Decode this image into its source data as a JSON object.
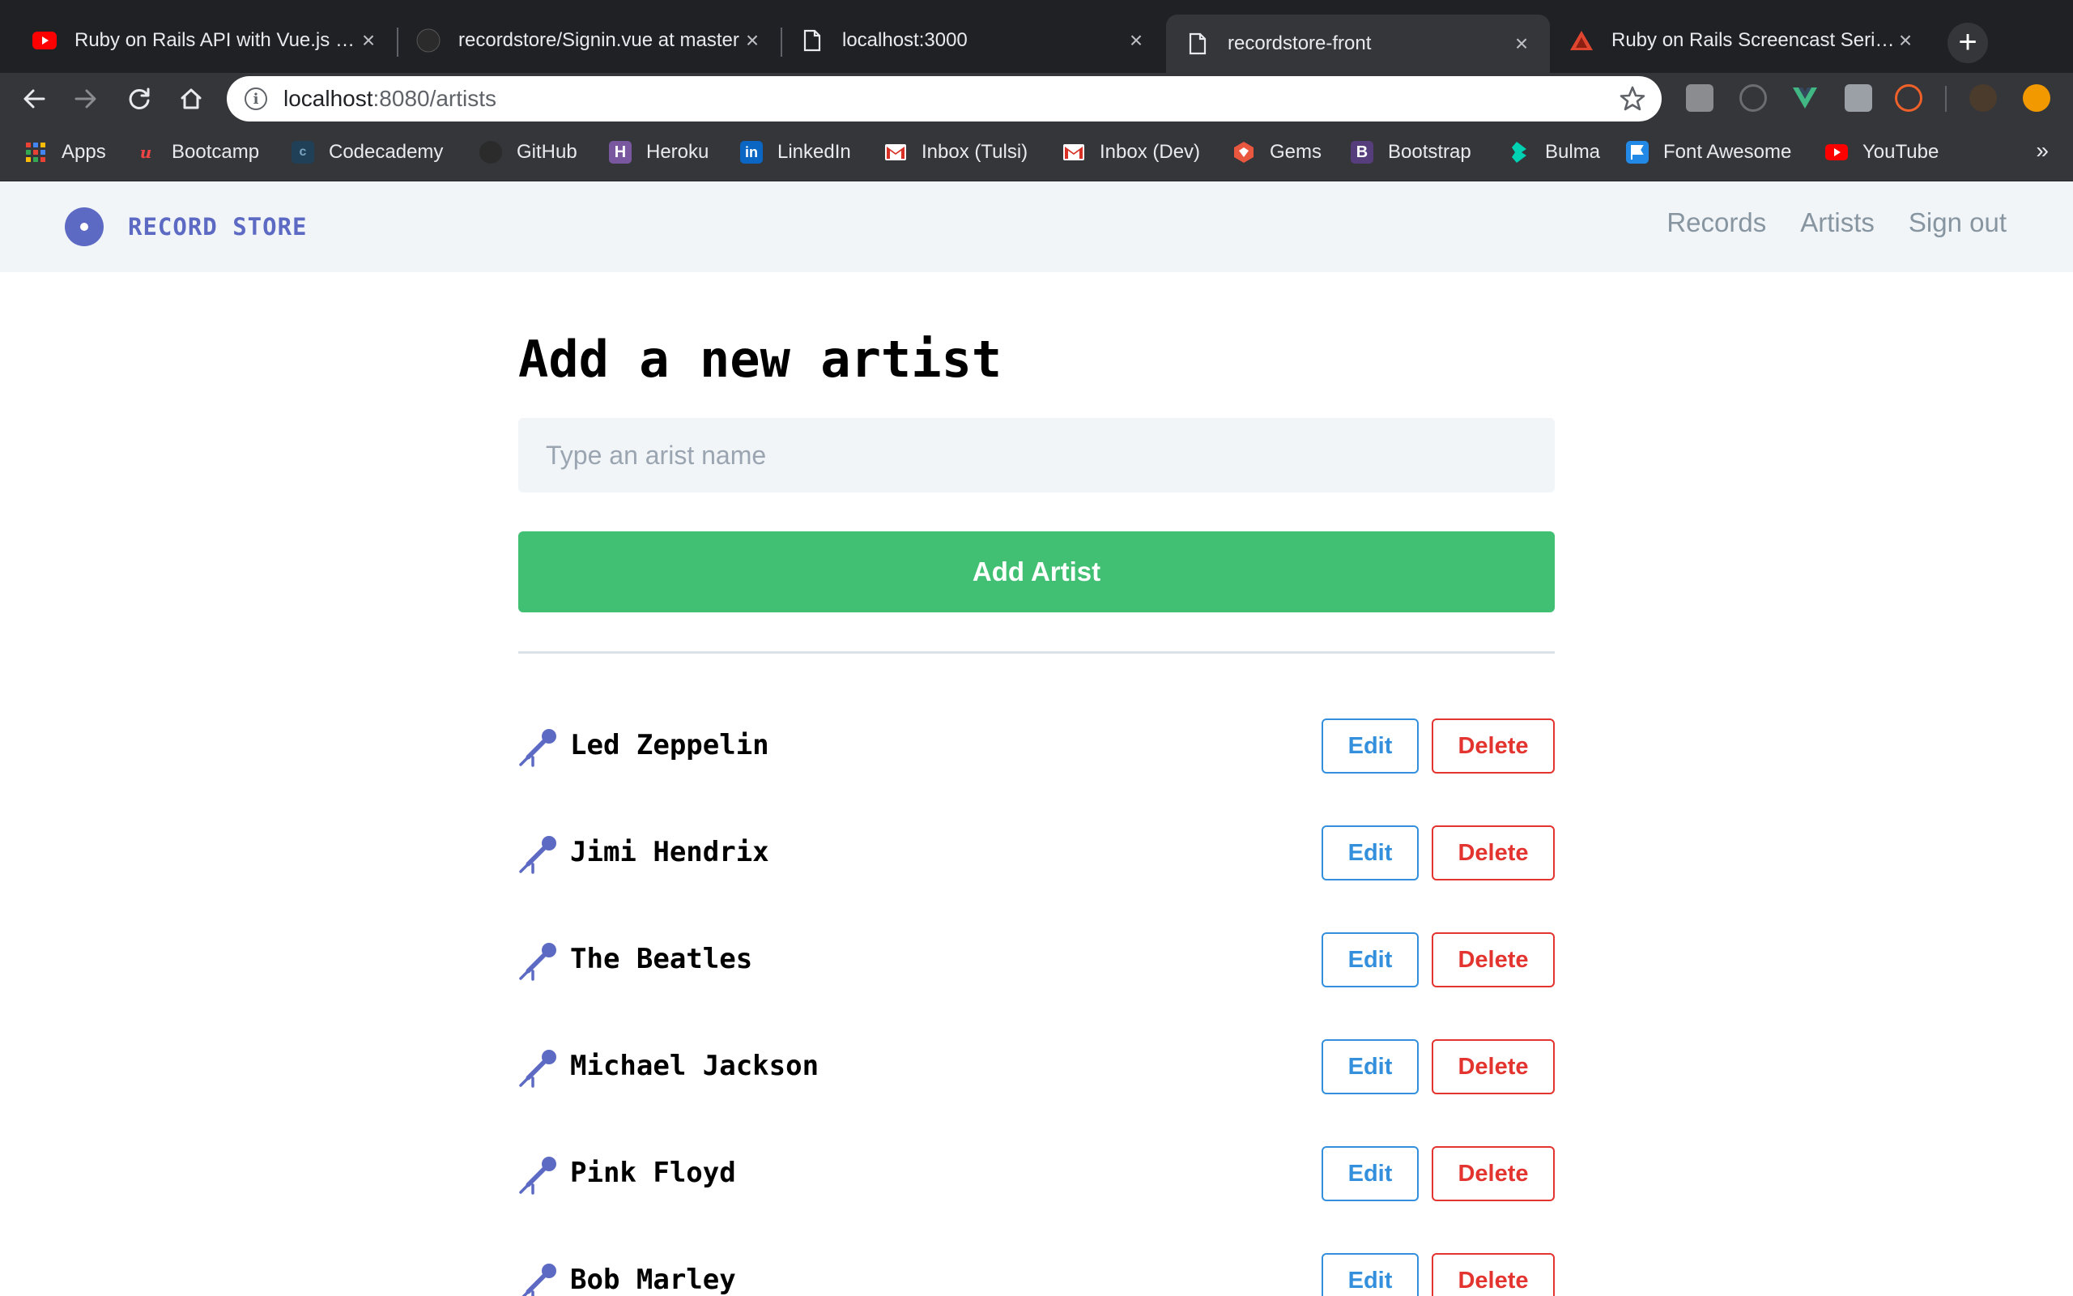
{
  "browser": {
    "tabs": [
      {
        "title": "Ruby on Rails API with Vue.js - YouTube",
        "favicon": "youtube-icon",
        "active": false
      },
      {
        "title": "recordstore/Signin.vue at master",
        "favicon": "github-icon",
        "active": false
      },
      {
        "title": "localhost:3000",
        "favicon": "page-icon",
        "active": false
      },
      {
        "title": "recordstore-front",
        "favicon": "page-icon",
        "active": true
      },
      {
        "title": "Ruby on Rails Screencast Series",
        "favicon": "triangle-logo-icon",
        "active": false
      }
    ],
    "new_tab_label": "+",
    "url_host": "localhost",
    "url_path": ":8080/artists",
    "bookmarks": [
      {
        "label": "Apps",
        "icon": "apps-grid-icon",
        "color": "#ea4335"
      },
      {
        "label": "Bootcamp",
        "icon": "bootcamp-icon",
        "color": "#ef4444"
      },
      {
        "label": "Codecademy",
        "icon": "codecademy-icon",
        "color": "#1f4056"
      },
      {
        "label": "GitHub",
        "icon": "github-icon",
        "color": "#24292e"
      },
      {
        "label": "Heroku",
        "icon": "heroku-icon",
        "color": "#79589f"
      },
      {
        "label": "LinkedIn",
        "icon": "linkedin-icon",
        "color": "#0a66c2"
      },
      {
        "label": "Inbox (Tulsi)",
        "icon": "gmail-icon",
        "color": "#ffffff"
      },
      {
        "label": "Inbox (Dev)",
        "icon": "gmail-icon",
        "color": "#ffffff"
      },
      {
        "label": "Gems",
        "icon": "rubygems-icon",
        "color": "#e9573f"
      },
      {
        "label": "Bootstrap",
        "icon": "bootstrap-icon",
        "color": "#563d7c"
      },
      {
        "label": "Bulma",
        "icon": "bulma-icon",
        "color": "#00d1b2"
      },
      {
        "label": "Font Awesome",
        "icon": "font-awesome-flag-icon",
        "color": "#228ae6"
      },
      {
        "label": "YouTube",
        "icon": "youtube-icon",
        "color": "#ff0000"
      }
    ],
    "bookmarks_overflow": "»"
  },
  "app": {
    "brand": "RECORD STORE",
    "nav": {
      "records": "Records",
      "artists": "Artists",
      "sign_out": "Sign out"
    },
    "colors": {
      "brand": "#5c6ac4",
      "nav_bg": "#f1f5f8",
      "add": "#41c074",
      "edit": "#3490dc",
      "delete": "#e3342f"
    }
  },
  "form": {
    "heading": "Add a new artist",
    "placeholder": "Type an arist name",
    "value": "",
    "submit_label": "Add Artist"
  },
  "artists": [
    {
      "name": "Led Zeppelin",
      "edit_label": "Edit",
      "delete_label": "Delete"
    },
    {
      "name": "Jimi Hendrix",
      "edit_label": "Edit",
      "delete_label": "Delete"
    },
    {
      "name": "The Beatles",
      "edit_label": "Edit",
      "delete_label": "Delete"
    },
    {
      "name": "Michael Jackson",
      "edit_label": "Edit",
      "delete_label": "Delete"
    },
    {
      "name": "Pink Floyd",
      "edit_label": "Edit",
      "delete_label": "Delete"
    },
    {
      "name": "Bob Marley",
      "edit_label": "Edit",
      "delete_label": "Delete"
    }
  ]
}
